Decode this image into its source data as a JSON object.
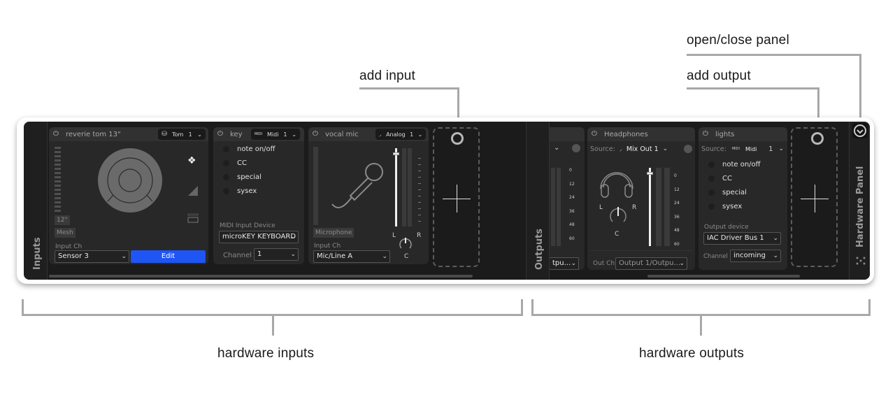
{
  "annotations": {
    "open_close_panel": "open/close panel",
    "add_output": "add output",
    "add_input": "add input",
    "hardware_inputs": "hardware inputs",
    "hardware_outputs": "hardware outputs"
  },
  "panel": {
    "inputs_tab": "Inputs",
    "outputs_tab": "Outputs",
    "hardware_panel_tab": "Hardware Panel"
  },
  "inputs": {
    "drum": {
      "name": "reverie tom 13\"",
      "type_label": "Tom",
      "type_channel": "1",
      "size_tag": "12\"",
      "head_tag": "Mesh",
      "input_ch_label": "Input Ch",
      "input_ch_value": "Sensor 3",
      "edit_label": "Edit"
    },
    "midi": {
      "name": "key",
      "type_label": "Midi",
      "type_channel": "1",
      "midi_icon": "MIDI",
      "rows": [
        "note on/off",
        "CC",
        "special",
        "sysex"
      ],
      "device_label": "MIDI Input Device",
      "device_value": "microKEY KEYBOARD",
      "channel_label": "Channel",
      "channel_value": "1"
    },
    "mic": {
      "name": "vocal mic",
      "type_label": "Analog",
      "type_channel": "1",
      "source_tag": "Microphone",
      "input_ch_label": "Input Ch",
      "input_ch_value": "Mic/Line A",
      "pan_left": "L",
      "pan_right": "R",
      "pan_center": "C"
    }
  },
  "outputs": {
    "partial": {
      "out_value": "tpu..."
    },
    "headphones": {
      "name": "Headphones",
      "source_label": "Source:",
      "source_value": "Mix Out 1",
      "meter_ticks": [
        "0",
        "12",
        "24",
        "36",
        "48",
        "60"
      ],
      "pan_left": "L",
      "pan_right": "R",
      "pan_center": "C",
      "out_ch_label": "Out Ch",
      "out_ch_value": "Output 1/Outpu..."
    },
    "lights": {
      "name": "lights",
      "source_label": "Source:",
      "source_type": "Midi",
      "source_channel": "1",
      "midi_icon": "MIDI",
      "rows": [
        "note on/off",
        "CC",
        "special",
        "sysex"
      ],
      "device_label": "Output device",
      "device_value": "IAC Driver Bus 1",
      "channel_label": "Channel",
      "channel_value": "incoming"
    }
  }
}
